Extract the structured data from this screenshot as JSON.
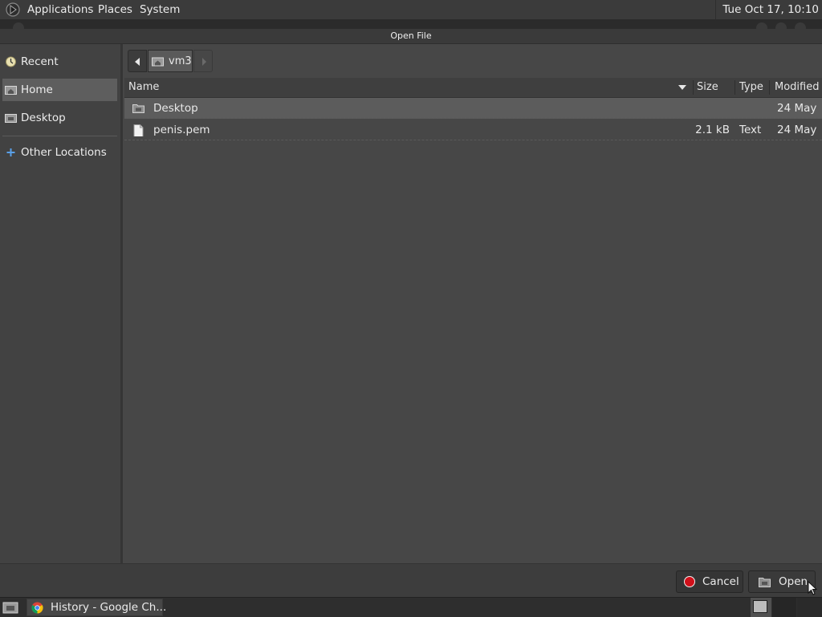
{
  "top_panel": {
    "menus": [
      "Applications",
      "Places",
      "System"
    ],
    "clock": "Tue Oct 17, 10:10"
  },
  "dialog": {
    "title": "Open File"
  },
  "sidebar": {
    "items": [
      {
        "label": "Recent",
        "icon": "recent-icon"
      },
      {
        "label": "Home",
        "icon": "home-folder-icon",
        "selected": true
      },
      {
        "label": "Desktop",
        "icon": "desktop-folder-icon"
      },
      {
        "label": "Other Locations",
        "icon": "plus-icon"
      }
    ]
  },
  "path_bar": {
    "crumbs": [
      "vm3"
    ]
  },
  "file_list": {
    "columns": [
      "Name",
      "Size",
      "Type",
      "Modified"
    ],
    "rows": [
      {
        "name": "Desktop",
        "size": "",
        "type": "",
        "modified": "24 May",
        "icon": "folder-icon",
        "selected": true
      },
      {
        "name": "penis.pem",
        "size": "2.1 kB",
        "type": "Text",
        "modified": "24 May",
        "icon": "text-file-icon"
      }
    ]
  },
  "buttons": {
    "cancel": "Cancel",
    "open": "Open"
  },
  "taskbar": {
    "task_label": "History - Google Ch..."
  },
  "colors": {
    "background": "#474747",
    "selection": "#5c5c5c",
    "cancel_red": "#d0101a"
  }
}
